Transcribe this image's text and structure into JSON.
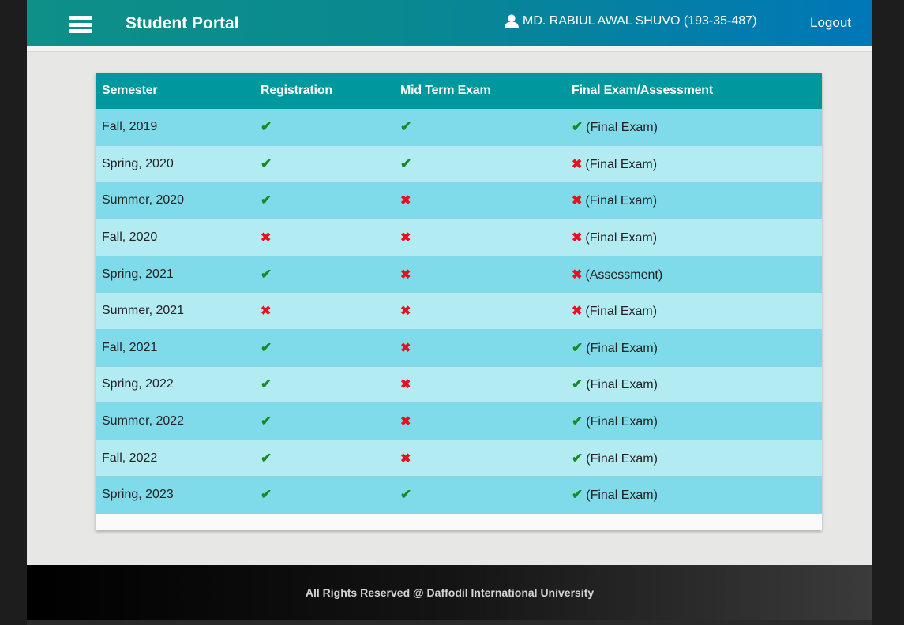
{
  "header": {
    "brand": "Student Portal",
    "user": "MD. RABIUL AWAL SHUVO (193-35-487)",
    "logout": "Logout"
  },
  "table": {
    "columns": [
      "Semester",
      "Registration",
      "Mid Term Exam",
      "Final Exam/Assessment"
    ],
    "rows": [
      {
        "semester": "Fall, 2019",
        "registration": true,
        "midterm": true,
        "final_ok": true,
        "final_label": "(Final Exam)"
      },
      {
        "semester": "Spring, 2020",
        "registration": true,
        "midterm": true,
        "final_ok": false,
        "final_label": "(Final Exam)"
      },
      {
        "semester": "Summer, 2020",
        "registration": true,
        "midterm": false,
        "final_ok": false,
        "final_label": "(Final Exam)"
      },
      {
        "semester": "Fall, 2020",
        "registration": false,
        "midterm": false,
        "final_ok": false,
        "final_label": "(Final Exam)"
      },
      {
        "semester": "Spring, 2021",
        "registration": true,
        "midterm": false,
        "final_ok": false,
        "final_label": "(Assessment)"
      },
      {
        "semester": "Summer, 2021",
        "registration": false,
        "midterm": false,
        "final_ok": false,
        "final_label": "(Final Exam)"
      },
      {
        "semester": "Fall, 2021",
        "registration": true,
        "midterm": false,
        "final_ok": true,
        "final_label": "(Final Exam)"
      },
      {
        "semester": "Spring, 2022",
        "registration": true,
        "midterm": false,
        "final_ok": true,
        "final_label": "(Final Exam)"
      },
      {
        "semester": "Summer, 2022",
        "registration": true,
        "midterm": false,
        "final_ok": true,
        "final_label": "(Final Exam)"
      },
      {
        "semester": "Fall, 2022",
        "registration": true,
        "midterm": false,
        "final_ok": true,
        "final_label": "(Final Exam)"
      },
      {
        "semester": "Spring, 2023",
        "registration": true,
        "midterm": true,
        "final_ok": true,
        "final_label": "(Final Exam)"
      }
    ]
  },
  "icons": {
    "check": "check-icon",
    "cross": "cross-icon",
    "user": "user-icon",
    "menu": "hamburger-menu-icon"
  },
  "colors": {
    "header_start": "#0e8f88",
    "header_end": "#0077b8",
    "table_header": "#00989f",
    "row_dark": "#7fdbea",
    "row_light": "#b3ebf2",
    "check": "#178a21",
    "cross": "#e8101c"
  },
  "footer": {
    "text": "All Rights Reserved @ Daffodil International University"
  }
}
